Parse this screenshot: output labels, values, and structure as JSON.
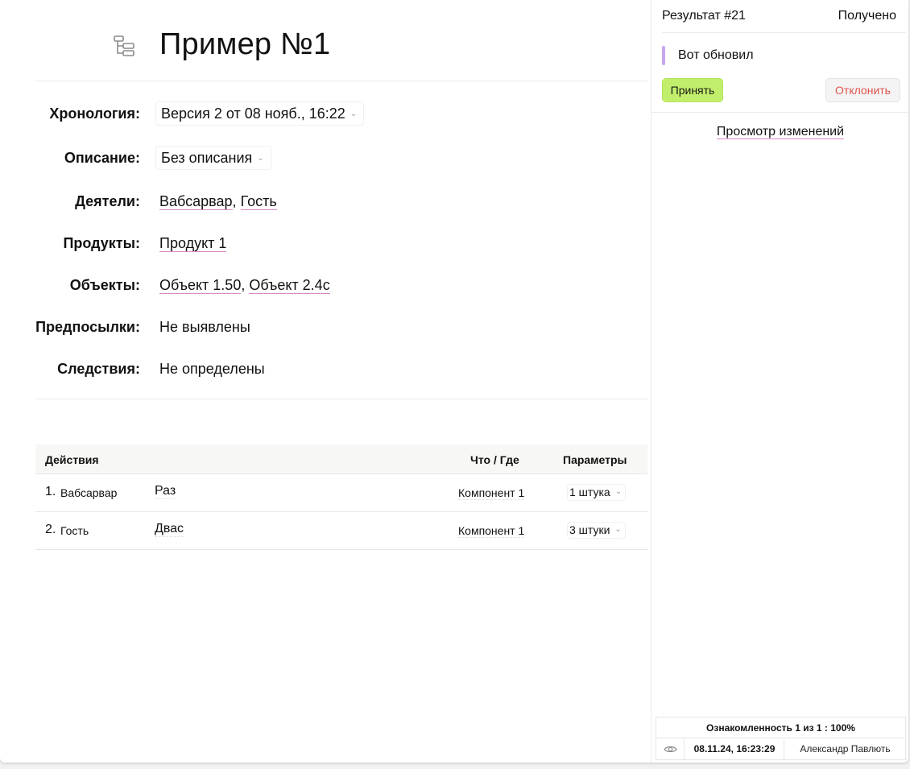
{
  "page": {
    "title": "Пример №1",
    "icon": "tree-structure-icon"
  },
  "fields": {
    "chronology": {
      "label": "Хронология:",
      "value": "Версия 2 от 08 нояб., 16:22"
    },
    "description": {
      "label": "Описание:",
      "value": "Без описания"
    },
    "actors": {
      "label": "Деятели:",
      "items": [
        "Вабсарвар",
        "Гость"
      ],
      "separator": ","
    },
    "products": {
      "label": "Продукты:",
      "items": [
        "Продукт 1"
      ]
    },
    "objects": {
      "label": "Объекты:",
      "items": [
        "Объект 1.50",
        "Объект 2.4с"
      ],
      "separator": ","
    },
    "preconditions": {
      "label": "Предпосылки:",
      "value": "Не выявлены"
    },
    "consequences": {
      "label": "Следствия:",
      "value": "Не определены"
    }
  },
  "actions_table": {
    "columns": {
      "actions": "Действия",
      "what_where": "Что / Где",
      "params": "Параметры"
    },
    "rows": [
      {
        "num": "1.",
        "actor": "Вабсарвар",
        "action": "Раз",
        "component": "Компонент 1",
        "param": "1 штука"
      },
      {
        "num": "2.",
        "actor": "Гость",
        "action": "Двас",
        "component": "Компонент 1",
        "param": "3 штуки"
      }
    ]
  },
  "result_panel": {
    "title": "Результат #21",
    "status": "Получено",
    "comment": "Вот обновил",
    "accept_label": "Принять",
    "reject_label": "Отклонить",
    "view_changes_label": "Просмотр изменений",
    "acknowledgement": {
      "summary": "Ознакомленность 1 из 1 : 100%",
      "icon": "eye-icon",
      "date": "08.11.24, 16:23:29",
      "user": "Александр Павлють"
    }
  },
  "colors": {
    "accept_bg": "#c2ef6b",
    "reject_text": "#e0554f",
    "comment_bar": "#c8a6ee",
    "link_underline": "#d98ac8"
  }
}
